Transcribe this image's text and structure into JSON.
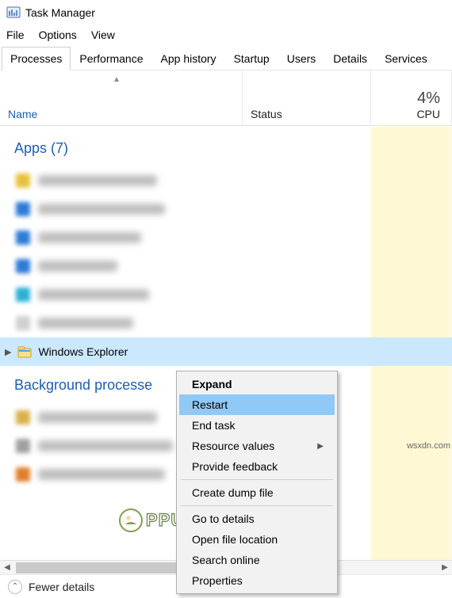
{
  "window": {
    "title": "Task Manager"
  },
  "menubar": {
    "file": "File",
    "options": "Options",
    "view": "View"
  },
  "tabs": {
    "processes": "Processes",
    "performance": "Performance",
    "app_history": "App history",
    "startup": "Startup",
    "users": "Users",
    "details": "Details",
    "services": "Services"
  },
  "columns": {
    "name": "Name",
    "status": "Status",
    "cpu_value": "4%",
    "cpu_label": "CPU"
  },
  "groups": {
    "apps_header": "Apps (7)",
    "background_header": "Background processe"
  },
  "selected_row": {
    "name": "Windows Explorer"
  },
  "context_menu": {
    "expand": "Expand",
    "restart": "Restart",
    "end_task": "End task",
    "resource_values": "Resource values",
    "provide_feedback": "Provide feedback",
    "create_dump": "Create dump file",
    "go_to_details": "Go to details",
    "open_file_location": "Open file location",
    "search_online": "Search online",
    "properties": "Properties"
  },
  "footer": {
    "fewer_details": "Fewer details"
  },
  "watermark": {
    "text": "PPUALS"
  },
  "source": {
    "tag": "wsxdn.com"
  }
}
